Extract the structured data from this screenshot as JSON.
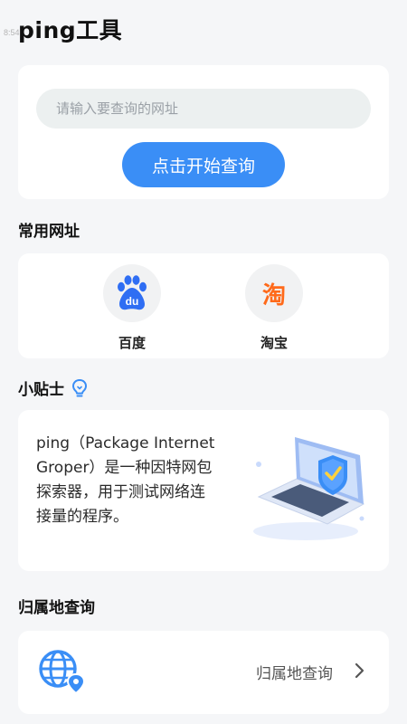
{
  "status": {
    "time": "8:54"
  },
  "header": {
    "title": "ping工具"
  },
  "search": {
    "placeholder": "请输入要查询的网址",
    "button_label": "点击开始查询"
  },
  "common_sites": {
    "title": "常用网址",
    "items": [
      {
        "label": "百度",
        "icon": "baidu-logo",
        "icon_text": "du"
      },
      {
        "label": "淘宝",
        "icon": "taobao-logo",
        "icon_text": "淘"
      }
    ]
  },
  "tips": {
    "title": "小贴士",
    "icon": "lightbulb-icon",
    "text": "ping（Package Internet Groper）是一种因特网包探索器，用于测试网络连接量的程序。",
    "illustration": "laptop-shield-illustration"
  },
  "location": {
    "section_title": "归属地查询",
    "item_label": "归属地查询",
    "icon": "globe-location-icon"
  },
  "colors": {
    "accent": "#3a8ef6",
    "baidu_blue": "#2f6ef3",
    "taobao_orange": "#ff6a1a",
    "background": "#f5f6f8"
  }
}
